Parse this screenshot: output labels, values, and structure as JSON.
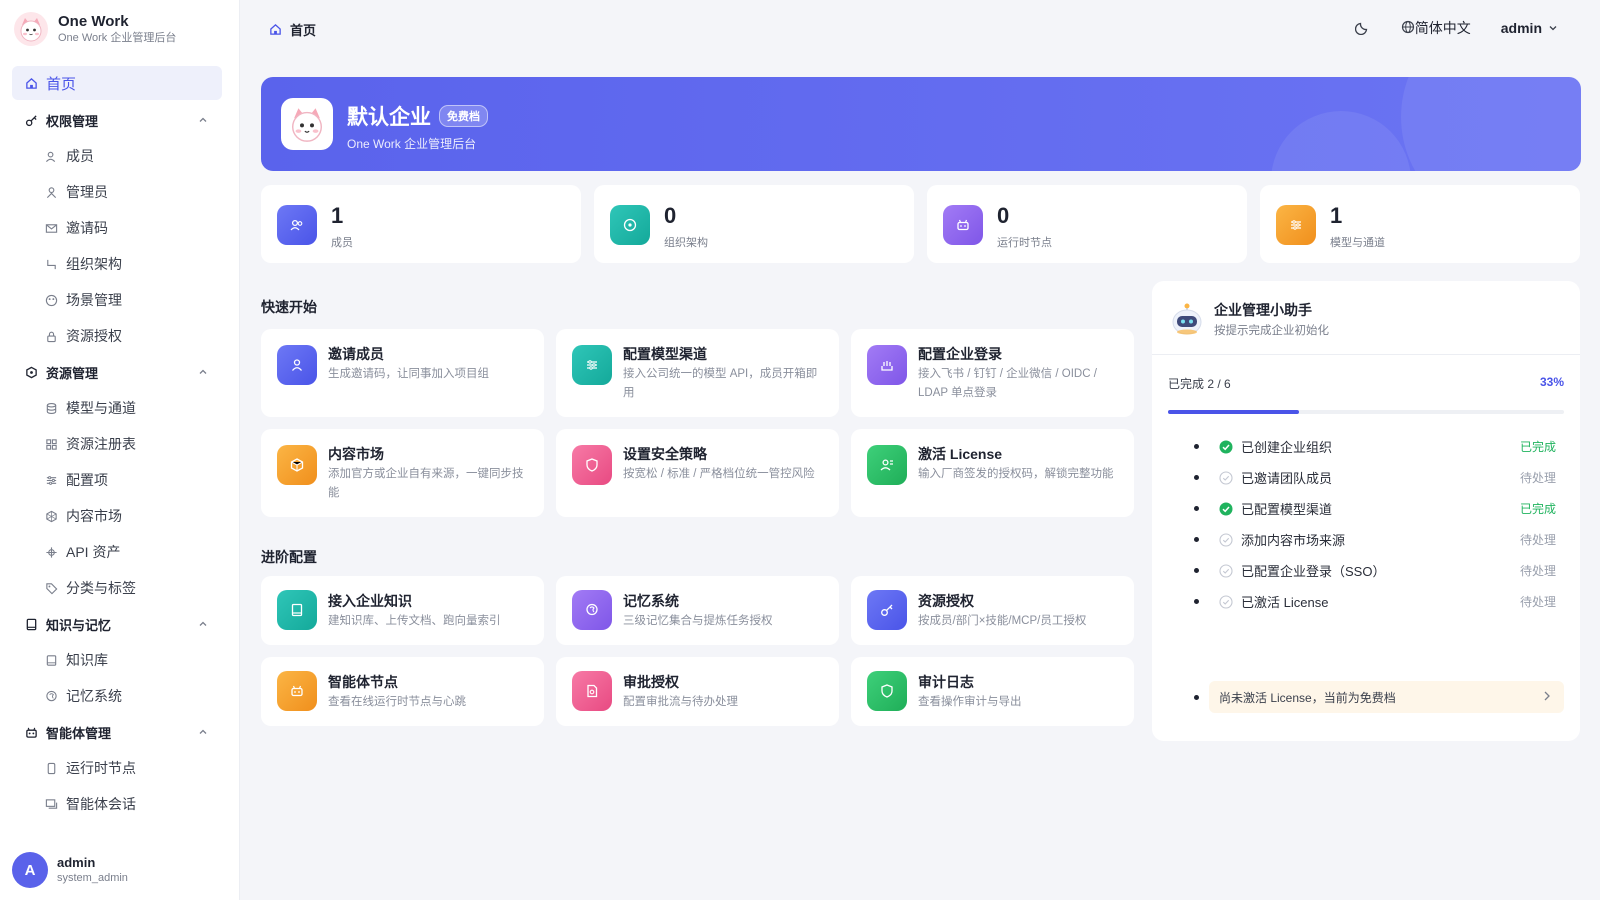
{
  "brand": {
    "title": "One Work",
    "subtitle": "One Work 企业管理后台"
  },
  "sidebar": {
    "home": "首页",
    "groups": [
      {
        "label": "权限管理",
        "items": [
          "成员",
          "管理员",
          "邀请码",
          "组织架构",
          "场景管理",
          "资源授权"
        ]
      },
      {
        "label": "资源管理",
        "items": [
          "模型与通道",
          "资源注册表",
          "配置项",
          "内容市场",
          "API 资产",
          "分类与标签"
        ]
      },
      {
        "label": "知识与记忆",
        "items": [
          "知识库",
          "记忆系统"
        ]
      },
      {
        "label": "智能体管理",
        "items": [
          "运行时节点",
          "智能体会话"
        ]
      }
    ]
  },
  "user": {
    "initial": "A",
    "name": "admin",
    "role": "system_admin"
  },
  "topbar": {
    "breadcrumb": "首页",
    "language": "简体中文",
    "account": "admin"
  },
  "hero": {
    "title": "默认企业",
    "badge": "免费档",
    "subtitle": "One Work 企业管理后台"
  },
  "stats": [
    {
      "value": "1",
      "label": "成员",
      "icon": "users-icon"
    },
    {
      "value": "0",
      "label": "组织架构",
      "icon": "org-icon"
    },
    {
      "value": "0",
      "label": "运行时节点",
      "icon": "robot-icon"
    },
    {
      "value": "1",
      "label": "模型与通道",
      "icon": "sliders-icon"
    }
  ],
  "quick_start": {
    "title": "快速开始",
    "cards": [
      {
        "title": "邀请成员",
        "desc": "生成邀请码，让同事加入项目组"
      },
      {
        "title": "配置模型渠道",
        "desc": "接入公司统一的模型 API，成员开箱即用"
      },
      {
        "title": "配置企业登录",
        "desc": "接入飞书 / 钉钉 / 企业微信 / OIDC / LDAP 单点登录"
      },
      {
        "title": "内容市场",
        "desc": "添加官方或企业自有来源，一键同步技能"
      },
      {
        "title": "设置安全策略",
        "desc": "按宽松 / 标准 / 严格档位统一管控风险"
      },
      {
        "title": "激活 License",
        "desc": "输入厂商签发的授权码，解锁完整功能"
      }
    ]
  },
  "advanced": {
    "title": "进阶配置",
    "cards": [
      {
        "title": "接入企业知识",
        "desc": "建知识库、上传文档、跑向量索引"
      },
      {
        "title": "记忆系统",
        "desc": "三级记忆集合与提炼任务授权"
      },
      {
        "title": "资源授权",
        "desc": "按成员/部门×技能/MCP/员工授权"
      },
      {
        "title": "智能体节点",
        "desc": "查看在线运行时节点与心跳"
      },
      {
        "title": "审批授权",
        "desc": "配置审批流与待办处理"
      },
      {
        "title": "审计日志",
        "desc": "查看操作审计与导出"
      }
    ]
  },
  "assistant": {
    "title": "企业管理小助手",
    "subtitle": "按提示完成企业初始化",
    "progress_label": "已完成 2 / 6",
    "progress_pct": "33%",
    "progress_value": 0.33,
    "tasks": [
      {
        "label": "已创建企业组织",
        "status": "已完成",
        "done": true
      },
      {
        "label": "已邀请团队成员",
        "status": "待处理",
        "done": false
      },
      {
        "label": "已配置模型渠道",
        "status": "已完成",
        "done": true
      },
      {
        "label": "添加内容市场来源",
        "status": "待处理",
        "done": false
      },
      {
        "label": "已配置企业登录（SSO）",
        "status": "待处理",
        "done": false
      },
      {
        "label": "已激活 License",
        "status": "待处理",
        "done": false
      }
    ],
    "notice": "尚未激活 License，当前为免费档"
  },
  "colors": {
    "accent": "#4a54e8",
    "done": "#20b35e",
    "pending": "#9aa0ad"
  }
}
